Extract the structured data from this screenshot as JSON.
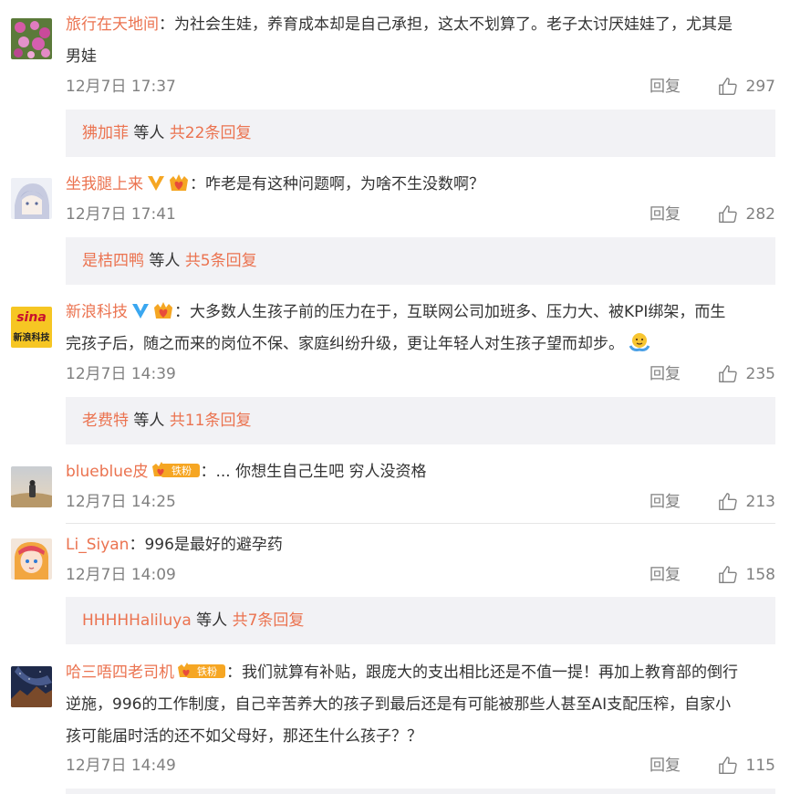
{
  "comments": [
    {
      "username": "旅行在天地间",
      "sep": "：",
      "text": "为社会生娃，养育成本却是自己承担，这太不划算了。老子太讨厌娃娃了，尤其是男娃",
      "line1": "为社会生娃，养育成本却是自己承担，这太不划算了。老子太讨厌娃娃了，尤其是",
      "line2": "男娃",
      "time": "12月7日 17:37",
      "reply_label": "回复",
      "likes": "297",
      "sub": {
        "user": "狒加菲",
        "mid": " 等人 ",
        "count": "共22条回复"
      }
    },
    {
      "username": "坐我腿上来",
      "sep": "：",
      "text": "咋老是有这种问题啊，为啥不生没数啊？",
      "time": "12月7日 17:41",
      "reply_label": "回复",
      "likes": "282",
      "sub": {
        "user": "是桔四鸭",
        "mid": " 等人 ",
        "count": "共5条回复"
      }
    },
    {
      "username": "新浪科技",
      "sep": "：",
      "line1": "大多数人生孩子前的压力在于，互联网公司加班多、压力大、被KPI绑架，而生",
      "line2": "完孩子后，随之而来的岗位不保、家庭纠纷升级，更让年轻人对生孩子望而却步。",
      "avatar_text": "sina",
      "avatar_sub": "新浪科技",
      "time": "12月7日 14:39",
      "reply_label": "回复",
      "likes": "235",
      "sub": {
        "user": "老费特",
        "mid": " 等人 ",
        "count": "共11条回复"
      }
    },
    {
      "username": "blueblue皮",
      "badge": "铁粉",
      "sep": "：",
      "text": "... 你想生自己生吧 穷人没资格",
      "time": "12月7日 14:25",
      "reply_label": "回复",
      "likes": "213"
    },
    {
      "username": "Li_Siyan",
      "sep": "：",
      "text": "996是最好的避孕药",
      "time": "12月7日 14:09",
      "reply_label": "回复",
      "likes": "158",
      "sub": {
        "user": "HHHHHaliluya",
        "mid": " 等人 ",
        "count": "共7条回复"
      }
    },
    {
      "username": "哈三唔四老司机",
      "badge": "铁粉",
      "sep": "：",
      "line1": "我们就算有补贴，跟庞大的支出相比还是不值一提！再加上教育部的倒行",
      "line2": "逆施，996的工作制度，自己辛苦养大的孩子到最后还是有可能被那些人甚至AI支配压榨，自家小",
      "line3": "孩可能届时活的还不如父母好，那还生什么孩子？？",
      "time": "12月7日 14:49",
      "reply_label": "回复",
      "likes": "115"
    }
  ],
  "colors": {
    "accent": "#eb7350",
    "meta": "#808080",
    "subreply_bg": "#f2f2f5"
  }
}
